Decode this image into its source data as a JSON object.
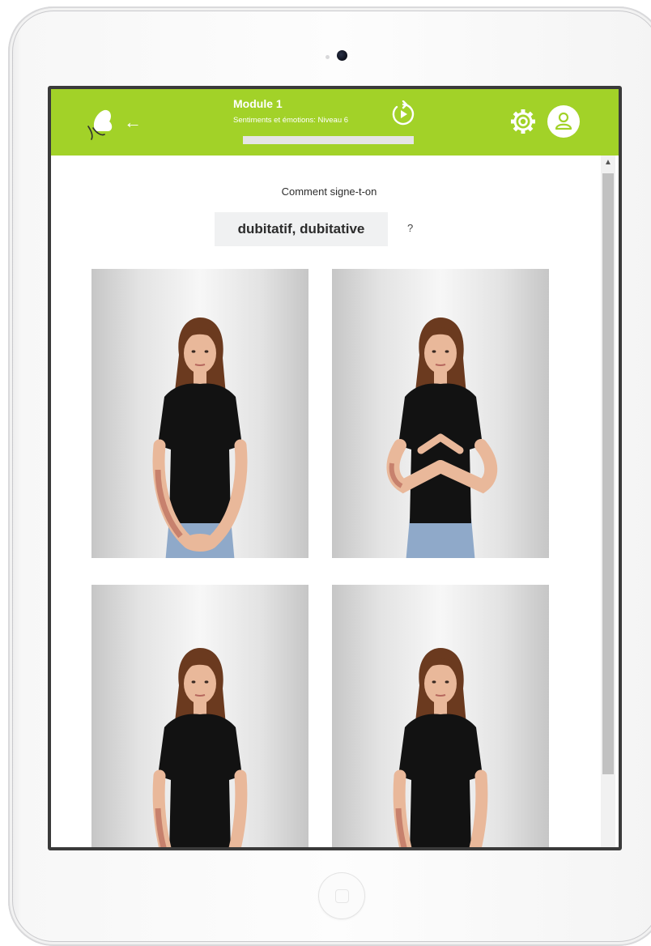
{
  "header": {
    "module_title": "Module 1",
    "module_subtitle": "Sentiments et émotions: Niveau 6",
    "progress": 0.06,
    "back_icon": "arrow-left-icon",
    "replay_icon": "replay-icon",
    "settings_icon": "gear-icon",
    "profile_icon": "user-icon",
    "accent_color": "#a2d228"
  },
  "quiz": {
    "prompt": "Comment signe-t-on",
    "word": "dubitatif, dubitative",
    "question_mark": "?"
  },
  "options": [
    {
      "pose": "hands-clasped-low"
    },
    {
      "pose": "hands-forming-roof"
    },
    {
      "pose": "arms-at-sides"
    },
    {
      "pose": "arms-at-sides"
    }
  ]
}
